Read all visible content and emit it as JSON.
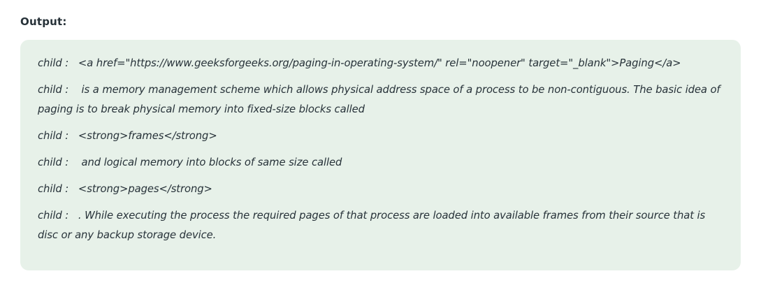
{
  "heading": "Output:",
  "output_lines": [
    "child :   <a href=\"https://www.geeksforgeeks.org/paging-in-operating-system/\" rel=\"noopener\" target=\"_blank\">Paging</a>",
    "child :    is a memory management scheme which allows physical address space of a process to be non-contiguous. The basic idea of paging is to break physical memory into fixed-size blocks called",
    "child :   <strong>frames</strong>",
    "child :    and logical memory into blocks of same size called",
    "child :   <strong>pages</strong>",
    "child :   . While executing the process the required pages of that process are loaded into available frames from their source that is disc or any backup storage device."
  ]
}
